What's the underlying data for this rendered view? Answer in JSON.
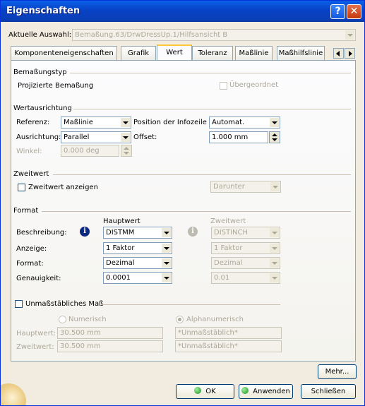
{
  "window": {
    "title": "Eigenschaften",
    "help_glyph": "?",
    "close_glyph": "✕"
  },
  "selection": {
    "label": "Aktuelle Auswahl:",
    "value": "Bemaßung.63/DrwDressUp.1/Hilfsansicht B"
  },
  "tabs": [
    {
      "label": "Komponenteneigenschaften"
    },
    {
      "label": "Grafik"
    },
    {
      "label": "Wert",
      "active": true
    },
    {
      "label": "Toleranz"
    },
    {
      "label": "Maßlinie"
    },
    {
      "label": "Maßhilfslinie"
    }
  ],
  "bemassungstyp": {
    "title": "Bemaßungstyp",
    "text": "Projizierte Bemaßung",
    "uebergeordnet_label": "Übergeordnet",
    "uebergeordnet_checked": false
  },
  "wertausrichtung": {
    "title": "Wertausrichtung",
    "referenz_label": "Referenz:",
    "referenz_value": "Maßlinie",
    "position_label": "Position der Infozeile",
    "position_value": "Automat.",
    "ausrichtung_label": "Ausrichtung:",
    "ausrichtung_value": "Parallel",
    "offset_label": "Offset:",
    "offset_value": "1.000 mm",
    "winkel_label": "Winkel:",
    "winkel_value": "0.000 deg"
  },
  "zweitwert": {
    "title": "Zweitwert",
    "anzeigen_label": "Zweitwert anzeigen",
    "anzeigen_checked": false,
    "position_value": "Darunter"
  },
  "format": {
    "title": "Format",
    "hauptwert_header": "Hauptwert",
    "zweitwert_header": "Zweitwert",
    "info_glyph": "i",
    "rows": [
      {
        "label": "Beschreibung:",
        "haupt": "DISTMM",
        "zweit": "DISTINCH"
      },
      {
        "label": "Anzeige:",
        "haupt": "1 Faktor",
        "zweit": "1 Faktor"
      },
      {
        "label": "Format:",
        "haupt": "Dezimal",
        "zweit": "Dezimal"
      },
      {
        "label": "Genauigkeit:",
        "haupt": "0.0001",
        "zweit": "0.01"
      }
    ]
  },
  "unmassstaeblich": {
    "title": "Unmaßstäbliches Maß",
    "checked": false,
    "numerisch_label": "Numerisch",
    "alphanumerisch_label": "Alphanumerisch",
    "hauptwert_label": "Hauptwert:",
    "hauptwert_num": "30.500 mm",
    "hauptwert_alpha": "*Unmaßstäblich*",
    "zweitwert_label": "Zweitwert:",
    "zweitwert_num": "30.500 mm",
    "zweitwert_alpha": "*Unmaßstäblich*"
  },
  "buttons": {
    "mehr": "Mehr...",
    "ok": "OK",
    "anwenden": "Anwenden",
    "schliessen": "Schließen"
  },
  "colors": {
    "ok_dot": "#2ea32e",
    "apply_dot": "#2ea32e",
    "info_icon": "#0b2780"
  }
}
